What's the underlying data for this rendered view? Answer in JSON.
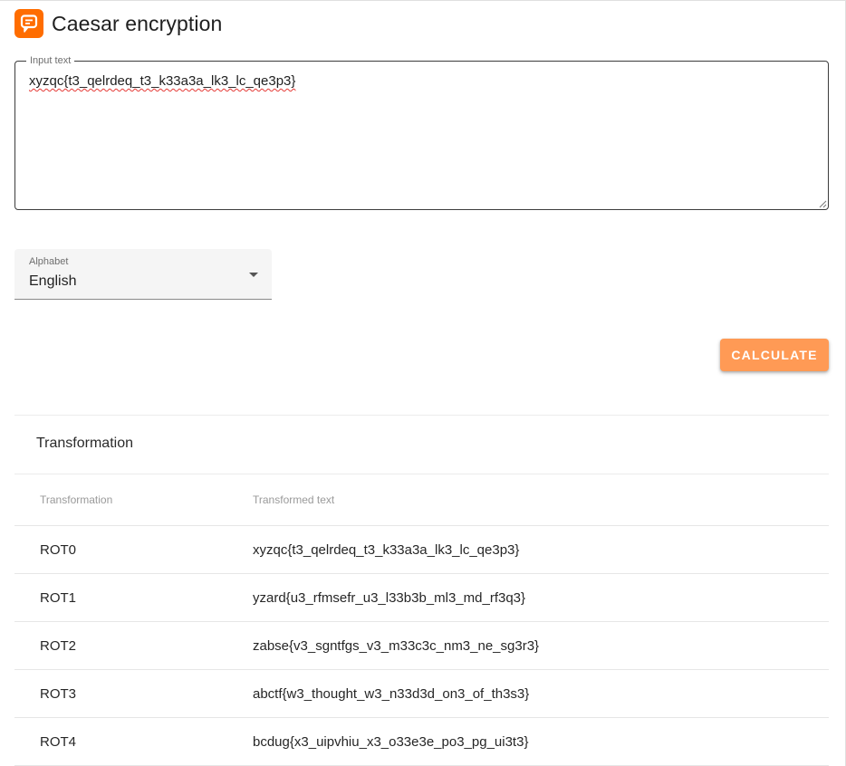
{
  "app": {
    "title": "Caesar encryption",
    "logo_icon": "message-square-icon",
    "accent_color": "#ff6d00"
  },
  "input": {
    "label": "Input text",
    "value": "xyzqc{t3_qelrdeq_t3_k33a3a_lk3_lc_qe3p3}"
  },
  "alphabet": {
    "label": "Alphabet",
    "value": "English"
  },
  "calculate_button": {
    "label": "CALCULATE",
    "color": "#ff9a55"
  },
  "results": {
    "title": "Transformation",
    "columns": [
      "Transformation",
      "Transformed text"
    ],
    "rows": [
      {
        "rot": "ROT0",
        "text": "xyzqc{t3_qelrdeq_t3_k33a3a_lk3_lc_qe3p3}"
      },
      {
        "rot": "ROT1",
        "text": "yzard{u3_rfmsefr_u3_l33b3b_ml3_md_rf3q3}"
      },
      {
        "rot": "ROT2",
        "text": "zabse{v3_sgntfgs_v3_m33c3c_nm3_ne_sg3r3}"
      },
      {
        "rot": "ROT3",
        "text": "abctf{w3_thought_w3_n33d3d_on3_of_th3s3}"
      },
      {
        "rot": "ROT4",
        "text": "bcdug{x3_uipvhiu_x3_o33e3e_po3_pg_ui3t3}"
      }
    ]
  }
}
